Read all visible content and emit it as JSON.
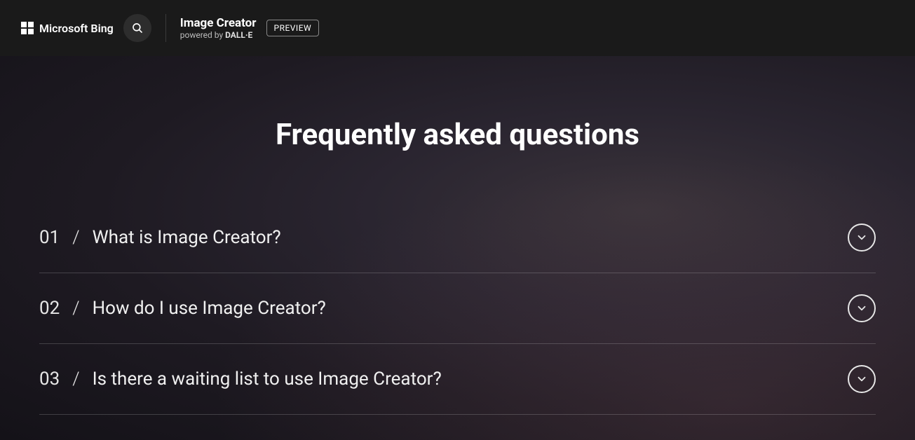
{
  "header": {
    "brand": "Microsoft Bing",
    "product_title": "Image Creator",
    "product_sub_prefix": "powered by ",
    "product_sub_brand": "DALL·E",
    "preview_label": "PREVIEW"
  },
  "page": {
    "title": "Frequently asked questions"
  },
  "faq": [
    {
      "num": "01",
      "question": "What is Image Creator?"
    },
    {
      "num": "02",
      "question": "How do I use Image Creator?"
    },
    {
      "num": "03",
      "question": "Is there a waiting list to use Image Creator?"
    }
  ]
}
